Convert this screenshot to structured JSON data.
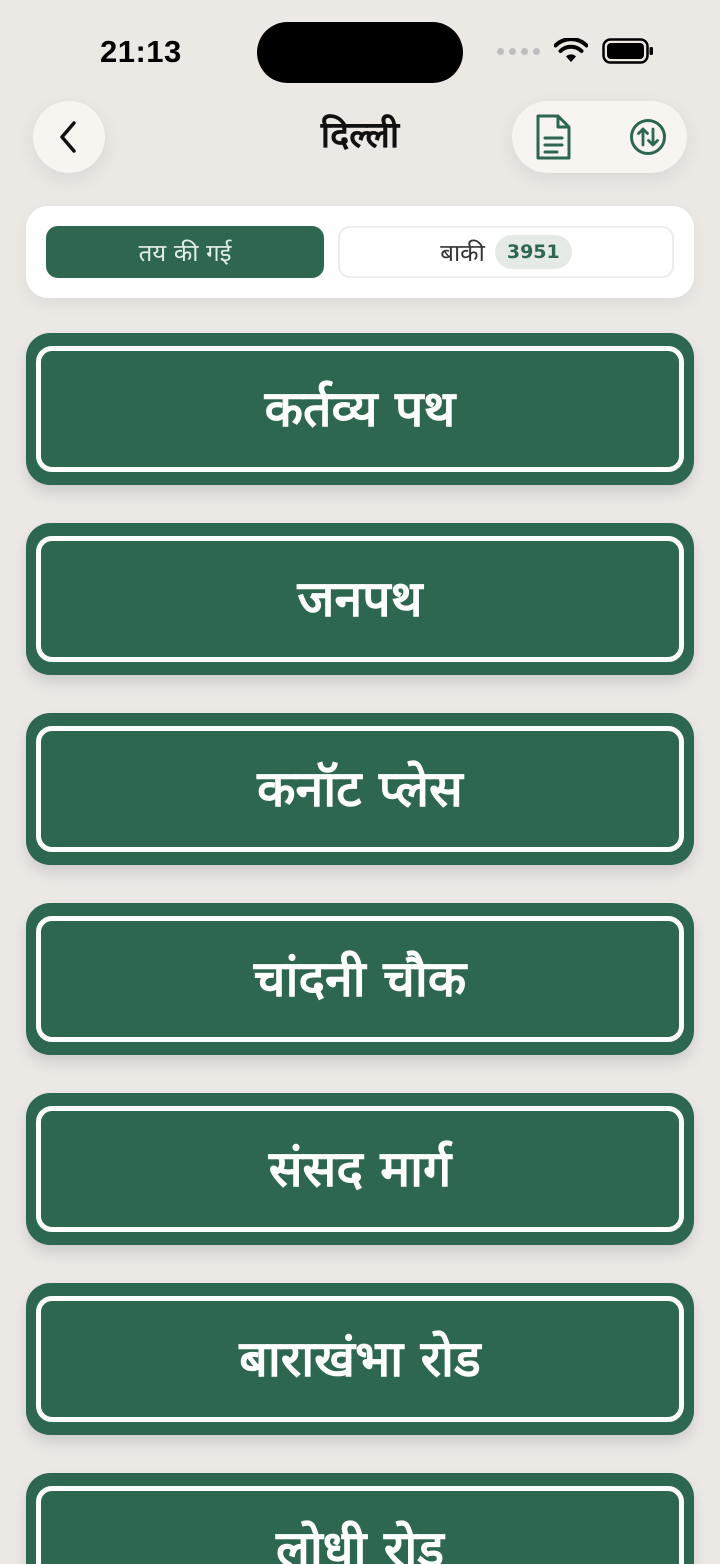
{
  "status_bar": {
    "time": "21:13"
  },
  "header": {
    "title": "दिल्ली"
  },
  "segments": {
    "selected_label": "तय की गई",
    "remaining_label": "बाकी",
    "remaining_count": "3951"
  },
  "streets": [
    {
      "name": "कर्तव्य पथ"
    },
    {
      "name": "जनपथ"
    },
    {
      "name": "कनॉट प्लेस"
    },
    {
      "name": "चांदनी चौक"
    },
    {
      "name": "संसद मार्ग"
    },
    {
      "name": "बाराखंभा रोड"
    },
    {
      "name": "लोधी रोड"
    }
  ],
  "colors": {
    "brand_green": "#2D674F",
    "background": "#ECE9E5",
    "surface": "#F8F5F0"
  },
  "icons": {
    "back": "chevron-left-icon",
    "document": "document-icon",
    "sort": "sort-arrows-icon"
  }
}
